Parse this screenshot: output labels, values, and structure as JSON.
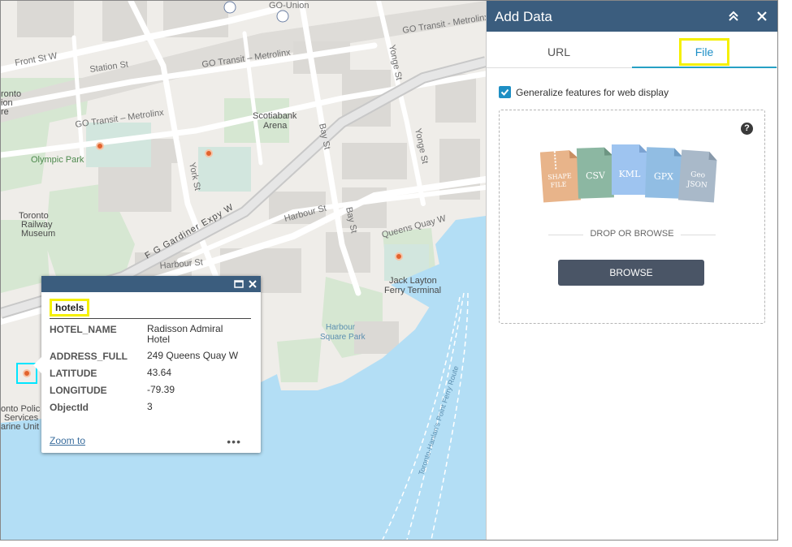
{
  "map": {
    "labels": {
      "go_union": "GO-Union",
      "go_transit_top": "GO Transit - Metrolinx",
      "go_transit_mid": "GO Transit – Metrolinx",
      "go_transit_left": "GO Transit – Metrolinx",
      "front_st": "Front St W",
      "station_st": "Station St",
      "scotiabank_1": "Scotiabank",
      "scotiabank_2": "Arena",
      "olympic_park": "Olympic Park",
      "york_st": "York St",
      "bay_st_top": "Bay St",
      "bay_st_low": "Bay St",
      "yonge_st_top": "Yonge St",
      "yonge_st_low": "Yonge St",
      "harbour_st_mid": "Harbour St",
      "harbour_st_left": "Harbour St",
      "gardiner": "F G Gardiner Expy W",
      "queens_quay": "Queens Quay W",
      "railway_1": "Toronto",
      "railway_2": "Railway",
      "railway_3": "Museum",
      "jack_layton_1": "Jack Layton",
      "jack_layton_2": "Ferry Terminal",
      "harbour_sq_1": "Harbour",
      "harbour_sq_2": "Square Park",
      "ferry_route": "Toronto-Hanlan's Point Ferry Route",
      "toronto_partial_1": "ronto",
      "toronto_partial_2": "ion",
      "toronto_partial_3": "re",
      "police_1": "onto Polic",
      "police_2": "Services",
      "police_3": "arine Unit"
    }
  },
  "popup": {
    "layer_title": "hotels",
    "rows": [
      {
        "key": "HOTEL_NAME",
        "value_line1": "Radisson Admiral",
        "value_line2": "Hotel"
      },
      {
        "key": "ADDRESS_FULL",
        "value_line1": "249 Queens Quay W",
        "value_line2": ""
      },
      {
        "key": "LATITUDE",
        "value_line1": "43.64",
        "value_line2": ""
      },
      {
        "key": "LONGITUDE",
        "value_line1": "-79.39",
        "value_line2": ""
      },
      {
        "key": "ObjectId",
        "value_line1": "3",
        "value_line2": ""
      }
    ],
    "zoom_to": "Zoom to",
    "more": "•••"
  },
  "panel": {
    "title": "Add Data",
    "tabs": {
      "url": "URL",
      "file": "File"
    },
    "generalize_label": "Generalize features for web display",
    "generalize_checked": true,
    "file_types": {
      "shape_1": "SHAPE",
      "shape_2": "FILE",
      "csv": "CSV",
      "kml": "KML",
      "gpx": "GPX",
      "geo_1": "Geo",
      "geo_2": "JSON"
    },
    "drop_text": "DROP OR BROWSE",
    "browse_label": "BROWSE",
    "help": "?"
  },
  "colors": {
    "header": "#3b5d7e",
    "accent": "#1e8fc4",
    "highlight": "#f5f000",
    "water": "#b3def5",
    "park": "#d6e7d2",
    "shape_file": "#e8b48a",
    "csv": "#8cb7a2",
    "kml": "#9ec4f0",
    "gpx": "#91bde3",
    "geojson": "#a9b9c9"
  }
}
